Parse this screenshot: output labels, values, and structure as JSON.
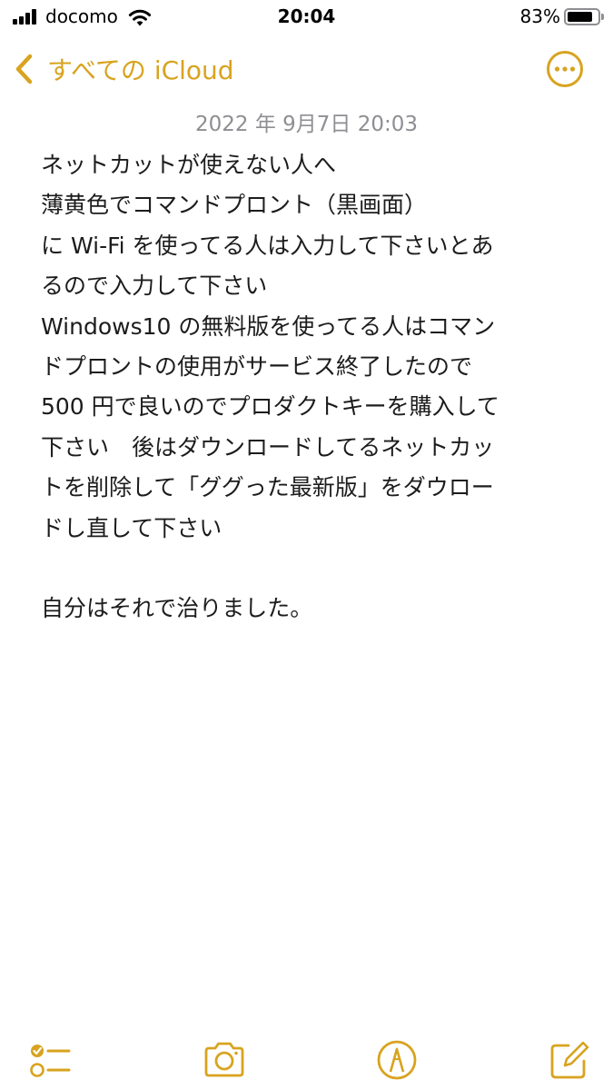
{
  "status_bar": {
    "carrier": "docomo",
    "time": "20:04",
    "battery_percent": "83%",
    "battery_level": 0.83,
    "icons": [
      "signal-icon",
      "wifi-icon",
      "battery-icon"
    ]
  },
  "nav": {
    "back_label": "すべての iCloud",
    "back_icon": "chevron-left-icon",
    "more_icon": "ellipsis-circle-icon"
  },
  "note": {
    "date": "2022 年 9月7日 20:03",
    "lines": [
      "ネットカットが使えない人へ",
      "薄黄色でコマンドプロント（黒画面）",
      "に Wi-Fi を使ってる人は入力して下さいとあ",
      "るので入力して下さい",
      "Windows10 の無料版を使ってる人はコマン",
      "ドプロントの使用がサービス終了したので",
      "500 円で良いのでプロダクトキーを購入して",
      "下さい　後はダウンロードしてるネットカッ",
      "トを削除して「ググった最新版」をダウロー",
      "ドし直して下さい",
      "",
      "自分はそれで治りました。"
    ]
  },
  "toolbar": {
    "icons": [
      "checklist-icon",
      "camera-icon",
      "markup-icon",
      "compose-icon"
    ]
  },
  "colors": {
    "accent": "#d8a31f",
    "text": "#1c1c1e",
    "secondary": "#8e8e93",
    "background": "#ffffff"
  }
}
